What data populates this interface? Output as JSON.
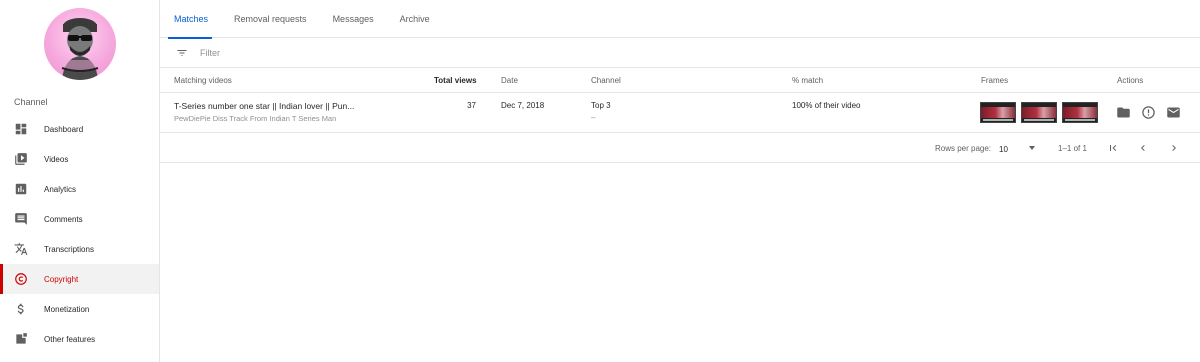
{
  "sidebar": {
    "section_label": "Channel",
    "items": [
      {
        "label": "Dashboard",
        "icon": "dashboard-icon"
      },
      {
        "label": "Videos",
        "icon": "videos-icon"
      },
      {
        "label": "Analytics",
        "icon": "analytics-icon"
      },
      {
        "label": "Comments",
        "icon": "comments-icon"
      },
      {
        "label": "Transcriptions",
        "icon": "translate-icon"
      },
      {
        "label": "Copyright",
        "icon": "copyright-icon",
        "active": true
      },
      {
        "label": "Monetization",
        "icon": "dollar-icon"
      },
      {
        "label": "Other features",
        "icon": "other-features-icon"
      }
    ]
  },
  "tabs": [
    {
      "label": "Matches",
      "active": true
    },
    {
      "label": "Removal requests"
    },
    {
      "label": "Messages"
    },
    {
      "label": "Archive"
    }
  ],
  "filter": {
    "placeholder": "Filter"
  },
  "table": {
    "headers": {
      "matching_videos": "Matching videos",
      "total_views": "Total views",
      "date": "Date",
      "channel": "Channel",
      "match": "% match",
      "frames": "Frames",
      "actions": "Actions"
    },
    "rows": [
      {
        "title": "T-Series number one star || Indian lover || Pun...",
        "subtitle": "PewDiePie Diss Track From Indian T Series Man",
        "views": "37",
        "date": "Dec 7, 2018",
        "channel": "Top 3",
        "channel_sub": "–",
        "match": "100% of their video"
      }
    ]
  },
  "pagination": {
    "rows_label": "Rows per page:",
    "rows_value": "10",
    "range": "1–1 of 1"
  },
  "colors": {
    "accent_blue": "#065fd4",
    "active_red": "#cc0000",
    "avatar_pink": "#f6a9de"
  }
}
